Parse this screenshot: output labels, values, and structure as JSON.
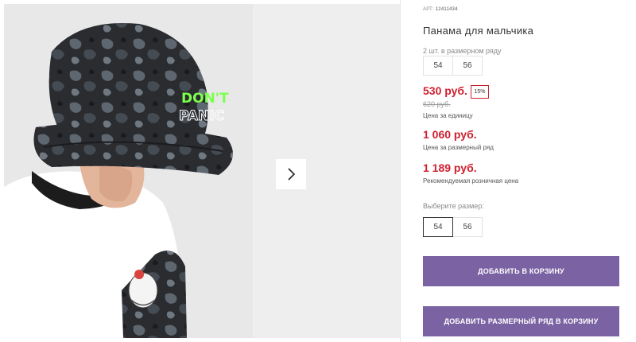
{
  "product": {
    "article_label": "АРТ:",
    "article_number": "12411434",
    "title": "Панама для мальчика",
    "set_note": "2 шт. в размерном ряду",
    "set_sizes": [
      "54",
      "56"
    ]
  },
  "pricing": {
    "unit_price": "530 руб.",
    "discount": "15%",
    "old_price": "620 руб.",
    "unit_label": "Цена за единицу",
    "set_price": "1 060 руб.",
    "set_label": "Цена за размерный ряд",
    "retail_price": "1 189 руб.",
    "retail_label": "Рекомендуемая розничная цена",
    "accent_color": "#cf2030"
  },
  "size_select": {
    "label": "Выберите размер:",
    "options": [
      "54",
      "56"
    ],
    "selected": "54"
  },
  "actions": {
    "add_to_cart": "ДОБАВИТЬ В КОРЗИНУ",
    "add_set_to_cart": "ДОБАВИТЬ РАЗМЕРНЫЙ РЯД В КОРЗИНУ",
    "button_color": "#7b62a3"
  },
  "gallery": {
    "hat_print": [
      "DON'T",
      "PANIC"
    ],
    "next_icon": "chevron-right-icon"
  }
}
